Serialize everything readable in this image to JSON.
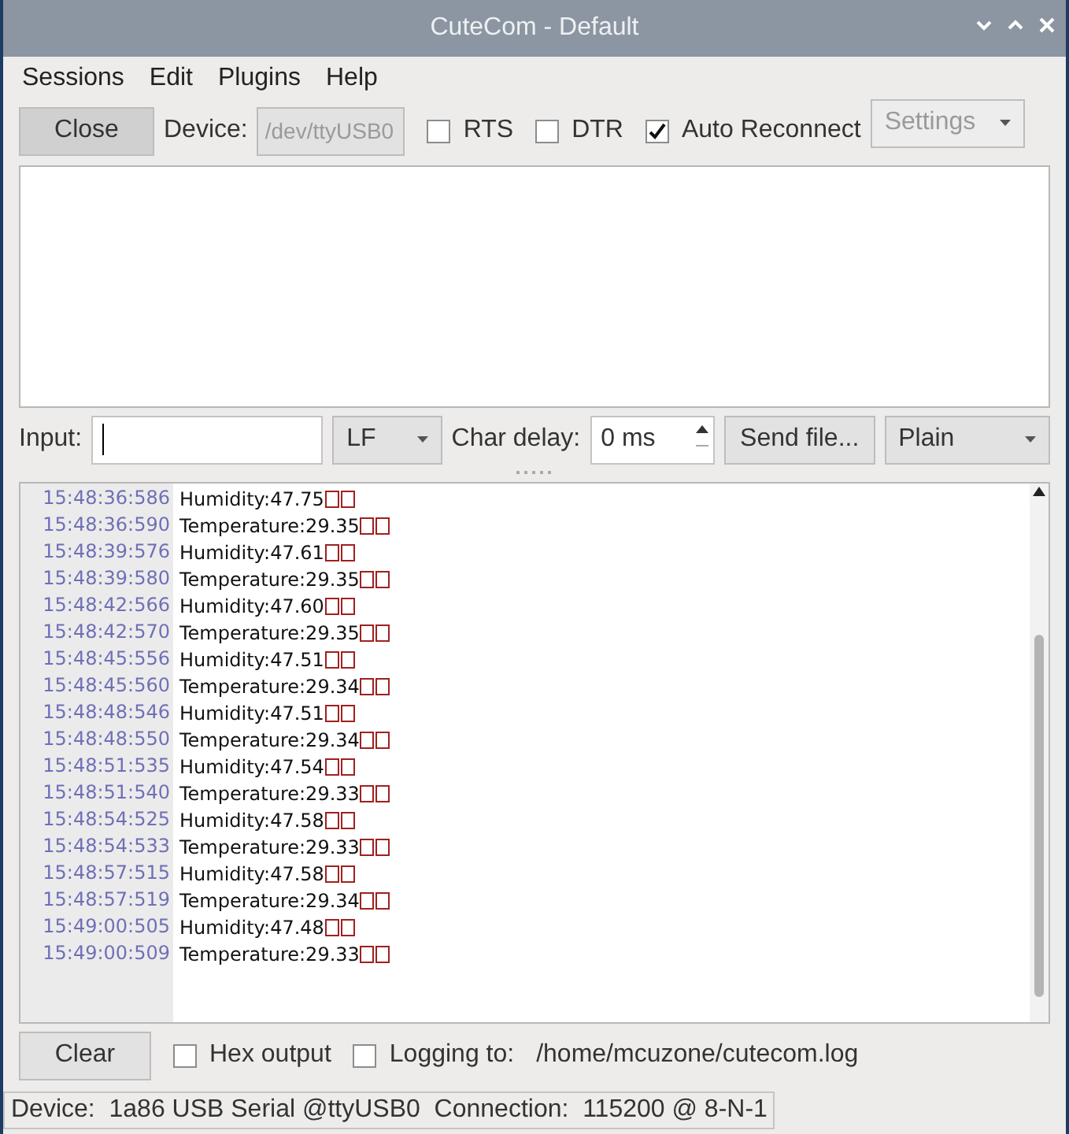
{
  "window": {
    "title": "CuteCom - Default"
  },
  "menu": [
    "Sessions",
    "Edit",
    "Plugins",
    "Help"
  ],
  "toolbar": {
    "close_button": "Close",
    "device_label": "Device:",
    "device": {
      "value": "/dev/ttyUSB0",
      "disabled": true
    },
    "options": [
      {
        "label": "RTS",
        "checked": false
      },
      {
        "label": "DTR",
        "checked": false
      },
      {
        "label": "Auto Reconnect",
        "checked": true
      }
    ],
    "settings_button": {
      "label": "Settings",
      "disabled": true
    }
  },
  "input_row": {
    "input_label": "Input:",
    "line_end": "LF",
    "char_delay_label": "Char delay:",
    "char_delay": "0 ms",
    "send_file": "Send file...",
    "format": "Plain"
  },
  "log": [
    {
      "time": "15:48:36:586",
      "text": "Humidity:47.75"
    },
    {
      "time": "15:48:36:590",
      "text": "Temperature:29.35"
    },
    {
      "time": "15:48:39:576",
      "text": "Humidity:47.61"
    },
    {
      "time": "15:48:39:580",
      "text": "Temperature:29.35"
    },
    {
      "time": "15:48:42:566",
      "text": "Humidity:47.60"
    },
    {
      "time": "15:48:42:570",
      "text": "Temperature:29.35"
    },
    {
      "time": "15:48:45:556",
      "text": "Humidity:47.51"
    },
    {
      "time": "15:48:45:560",
      "text": "Temperature:29.34"
    },
    {
      "time": "15:48:48:546",
      "text": "Humidity:47.51"
    },
    {
      "time": "15:48:48:550",
      "text": "Temperature:29.34"
    },
    {
      "time": "15:48:51:535",
      "text": "Humidity:47.54"
    },
    {
      "time": "15:48:51:540",
      "text": "Temperature:29.33"
    },
    {
      "time": "15:48:54:525",
      "text": "Humidity:47.58"
    },
    {
      "time": "15:48:54:533",
      "text": "Temperature:29.33"
    },
    {
      "time": "15:48:57:515",
      "text": "Humidity:47.58"
    },
    {
      "time": "15:48:57:519",
      "text": "Temperature:29.34"
    },
    {
      "time": "15:49:00:505",
      "text": "Humidity:47.48"
    },
    {
      "time": "15:49:00:509",
      "text": "Temperature:29.33"
    }
  ],
  "bottom": {
    "clear_button": "Clear",
    "hex_output": {
      "label": "Hex output",
      "checked": false
    },
    "logging": {
      "label": "Logging to:",
      "checked": false
    },
    "log_path": "/home/mcuzone/cutecom.log"
  },
  "status_bar": "Device:  1a86 USB Serial @ttyUSB0  Connection:  115200 @ 8-N-1"
}
